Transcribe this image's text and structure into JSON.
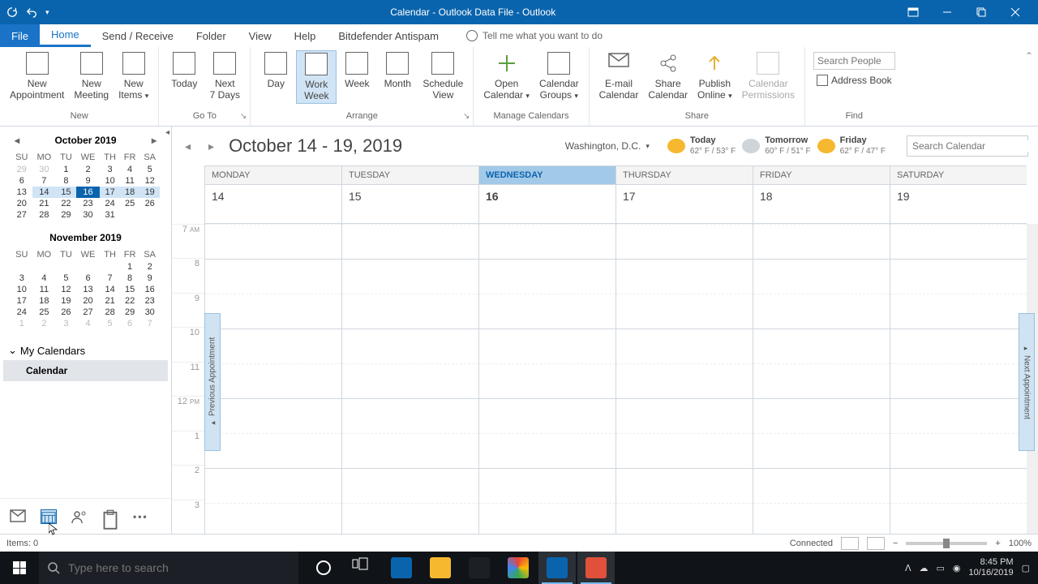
{
  "title": "Calendar - Outlook Data File  -  Outlook",
  "tabs": {
    "file": "File",
    "home": "Home",
    "sendreceive": "Send / Receive",
    "folder": "Folder",
    "view": "View",
    "help": "Help",
    "bitdefender": "Bitdefender Antispam",
    "tellme": "Tell me what you want to do"
  },
  "ribbon": {
    "new": {
      "label": "New",
      "appointment_l1": "New",
      "appointment_l2": "Appointment",
      "meeting_l1": "New",
      "meeting_l2": "Meeting",
      "items_l1": "New",
      "items_l2": "Items"
    },
    "goto": {
      "label": "Go To",
      "today": "Today",
      "next7_l1": "Next",
      "next7_l2": "7 Days"
    },
    "arrange": {
      "label": "Arrange",
      "day": "Day",
      "workweek_l1": "Work",
      "workweek_l2": "Week",
      "week": "Week",
      "month": "Month",
      "schedule_l1": "Schedule",
      "schedule_l2": "View"
    },
    "manage": {
      "label": "Manage Calendars",
      "open_l1": "Open",
      "open_l2": "Calendar",
      "groups_l1": "Calendar",
      "groups_l2": "Groups"
    },
    "share": {
      "label": "Share",
      "email_l1": "E-mail",
      "email_l2": "Calendar",
      "shr_l1": "Share",
      "shr_l2": "Calendar",
      "pub_l1": "Publish",
      "pub_l2": "Online",
      "perm_l1": "Calendar",
      "perm_l2": "Permissions"
    },
    "find": {
      "label": "Find",
      "search_ph": "Search People",
      "addressbook": "Address Book"
    }
  },
  "minical1": {
    "title": "October 2019",
    "dow": [
      "SU",
      "MO",
      "TU",
      "WE",
      "TH",
      "FR",
      "SA"
    ],
    "rows": [
      [
        {
          "n": 29,
          "o": 1
        },
        {
          "n": 30,
          "o": 1
        },
        {
          "n": 1
        },
        {
          "n": 2
        },
        {
          "n": 3
        },
        {
          "n": 4
        },
        {
          "n": 5
        }
      ],
      [
        {
          "n": 6
        },
        {
          "n": 7
        },
        {
          "n": 8
        },
        {
          "n": 9
        },
        {
          "n": 10
        },
        {
          "n": 11
        },
        {
          "n": 12
        }
      ],
      [
        {
          "n": 13
        },
        {
          "n": 14,
          "hl": 1
        },
        {
          "n": 15,
          "hl": 1
        },
        {
          "n": 16,
          "t": 1
        },
        {
          "n": 17,
          "hl": 1
        },
        {
          "n": 18,
          "hl": 1
        },
        {
          "n": 19,
          "hl": 1
        }
      ],
      [
        {
          "n": 20
        },
        {
          "n": 21
        },
        {
          "n": 22
        },
        {
          "n": 23
        },
        {
          "n": 24
        },
        {
          "n": 25
        },
        {
          "n": 26
        }
      ],
      [
        {
          "n": 27
        },
        {
          "n": 28
        },
        {
          "n": 29
        },
        {
          "n": 30
        },
        {
          "n": 31
        },
        {
          "n": "",
          "o": 1
        },
        {
          "n": "",
          "o": 1
        }
      ]
    ]
  },
  "minical2": {
    "title": "November 2019",
    "dow": [
      "SU",
      "MO",
      "TU",
      "WE",
      "TH",
      "FR",
      "SA"
    ],
    "rows": [
      [
        {
          "n": ""
        },
        {
          "n": ""
        },
        {
          "n": ""
        },
        {
          "n": ""
        },
        {
          "n": ""
        },
        {
          "n": 1
        },
        {
          "n": 2
        }
      ],
      [
        {
          "n": 3
        },
        {
          "n": 4
        },
        {
          "n": 5
        },
        {
          "n": 6
        },
        {
          "n": 7
        },
        {
          "n": 8
        },
        {
          "n": 9
        }
      ],
      [
        {
          "n": 10
        },
        {
          "n": 11
        },
        {
          "n": 12
        },
        {
          "n": 13
        },
        {
          "n": 14
        },
        {
          "n": 15
        },
        {
          "n": 16
        }
      ],
      [
        {
          "n": 17
        },
        {
          "n": 18
        },
        {
          "n": 19
        },
        {
          "n": 20
        },
        {
          "n": 21
        },
        {
          "n": 22
        },
        {
          "n": 23
        }
      ],
      [
        {
          "n": 24
        },
        {
          "n": 25
        },
        {
          "n": 26
        },
        {
          "n": 27
        },
        {
          "n": 28
        },
        {
          "n": 29
        },
        {
          "n": 30
        }
      ],
      [
        {
          "n": 1,
          "o": 1
        },
        {
          "n": 2,
          "o": 1
        },
        {
          "n": 3,
          "o": 1
        },
        {
          "n": 4,
          "o": 1
        },
        {
          "n": 5,
          "o": 1
        },
        {
          "n": 6,
          "o": 1
        },
        {
          "n": 7,
          "o": 1
        }
      ]
    ]
  },
  "mycals": {
    "header": "My Calendars",
    "item": "Calendar"
  },
  "main": {
    "title": "October 14 - 19, 2019",
    "location": "Washington, D.C.",
    "weather": [
      {
        "day": "Today",
        "temp": "62° F / 53° F",
        "color": "#f5b82e"
      },
      {
        "day": "Tomorrow",
        "temp": "60° F / 51° F",
        "color": "#cfd4d8"
      },
      {
        "day": "Friday",
        "temp": "62° F / 47° F",
        "color": "#f5b82e"
      }
    ],
    "search_ph": "Search Calendar",
    "days": [
      {
        "name": "MONDAY",
        "num": "14"
      },
      {
        "name": "TUESDAY",
        "num": "15"
      },
      {
        "name": "WEDNESDAY",
        "num": "16",
        "today": true
      },
      {
        "name": "THURSDAY",
        "num": "17"
      },
      {
        "name": "FRIDAY",
        "num": "18"
      },
      {
        "name": "SATURDAY",
        "num": "19"
      }
    ],
    "hours": [
      "7 AM",
      "8",
      "9",
      "10",
      "11",
      "12 PM",
      "1",
      "2",
      "3"
    ],
    "prevapp": "Previous Appointment",
    "nextapp": "Next Appointment"
  },
  "status": {
    "items": "Items: 0",
    "connected": "Connected",
    "zoom": "100%"
  },
  "taskbar": {
    "search_ph": "Type here to search",
    "time": "8:45 PM",
    "date": "10/16/2019",
    "apps": [
      {
        "name": "cortana",
        "color": "#1c1f25"
      },
      {
        "name": "taskview",
        "color": "#1c1f25"
      },
      {
        "name": "edge",
        "color": "#0a64ad"
      },
      {
        "name": "file-explorer",
        "color": "#f5b82e"
      },
      {
        "name": "microsoft-store",
        "color": "#1c1f25"
      },
      {
        "name": "chrome",
        "color": "linear"
      },
      {
        "name": "outlook",
        "color": "#0a64ad",
        "active": true
      },
      {
        "name": "snagit",
        "color": "#e0503b",
        "active": true
      }
    ]
  }
}
